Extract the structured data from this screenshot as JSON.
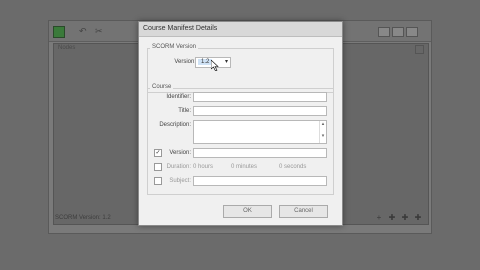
{
  "background": {
    "panel_title": "Nodes",
    "footer": "SCORM Version: 1.2"
  },
  "dialog": {
    "title": "Course Manifest Details",
    "scorm_group": "SCORM Version",
    "version_label": "Version:",
    "version_value": "1.2",
    "course_group": "Course",
    "identifier_label": "Identifier:",
    "title_label": "Title:",
    "description_label": "Description:",
    "course_version_label": "Version:",
    "duration_label": "Duration:",
    "hours": "0  hours",
    "minutes": "0  minutes",
    "seconds": "0  seconds",
    "subject_label": "Subject:",
    "ok": "OK",
    "cancel": "Cancel"
  }
}
